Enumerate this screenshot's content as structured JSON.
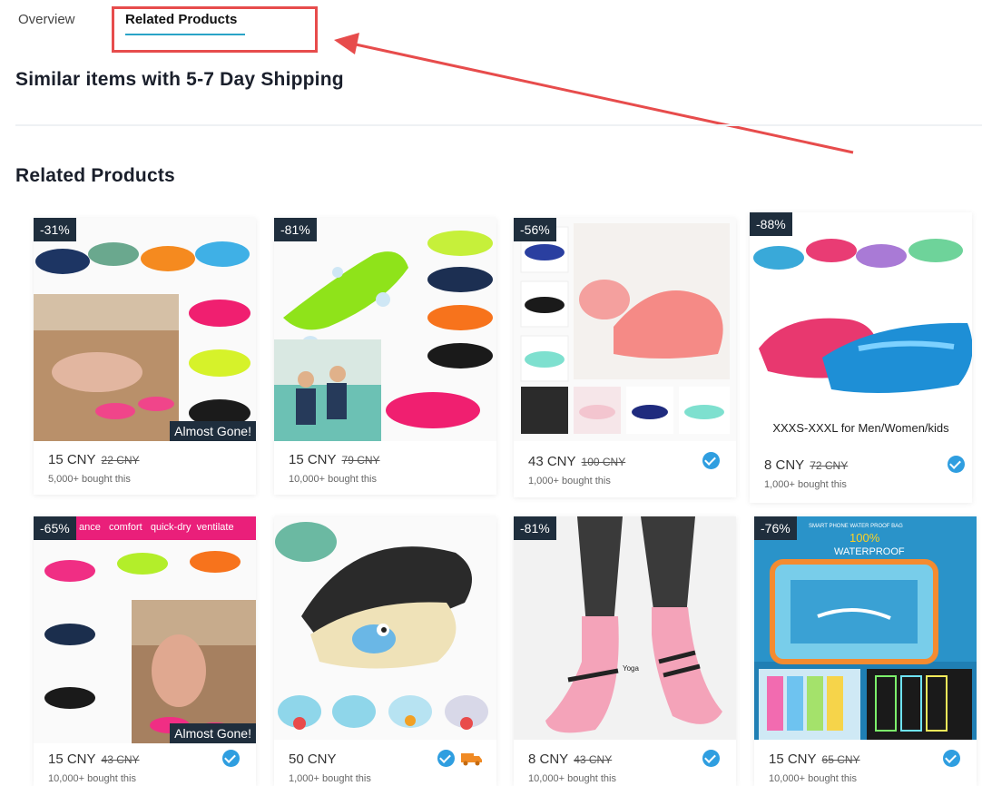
{
  "tabs": [
    {
      "label": "Overview"
    },
    {
      "label": "Related Products",
      "active": true
    }
  ],
  "headings": {
    "shipping": "Similar items with 5-7 Day Shipping",
    "related": "Related Products"
  },
  "colors": {
    "accent": "#2aa3c7",
    "annotation": "#e74c4c",
    "badge_bg": "#1f2e3d",
    "verified": "#2f9ee0"
  },
  "products": [
    {
      "discount": "-31%",
      "price": "15 CNY",
      "old_price": "22 CNY",
      "sold": "5,000+ bought this",
      "flag": "Almost Gone!",
      "verified": false,
      "image_icon": "water-shoes-image"
    },
    {
      "discount": "-81%",
      "price": "15 CNY",
      "old_price": "79 CNY",
      "sold": "10,000+ bought this",
      "verified": false,
      "image_icon": "water-shoes-image"
    },
    {
      "discount": "-56%",
      "price": "43 CNY",
      "old_price": "100 CNY",
      "sold": "1,000+ bought this",
      "verified": true,
      "image_icon": "water-shoes-image"
    },
    {
      "discount": "-88%",
      "price": "8 CNY",
      "old_price": "72 CNY",
      "sold": "1,000+ bought this",
      "caption": "XXXS-XXXL for Men/Women/kids",
      "verified": true,
      "image_icon": "water-shoes-image"
    },
    {
      "discount": "-65%",
      "price": "15 CNY",
      "old_price": "43 CNY",
      "sold": "10,000+ bought this",
      "flag": "Almost Gone!",
      "verified": true,
      "strip": "ance   comfort   quick-dry  ventilate",
      "image_icon": "water-shoes-image"
    },
    {
      "discount": "",
      "price": "50 CNY",
      "old_price": "",
      "sold": "1,000+ bought this",
      "verified": true,
      "truck": true,
      "image_icon": "kids-water-shoes-image"
    },
    {
      "discount": "-81%",
      "price": "8 CNY",
      "old_price": "43 CNY",
      "sold": "10,000+ bought this",
      "verified": true,
      "sock_text": "Yoga",
      "image_icon": "yoga-socks-image"
    },
    {
      "discount": "-76%",
      "price": "15 CNY",
      "old_price": "65 CNY",
      "sold": "10,000+ bought this",
      "verified": true,
      "banner": "SMART PHONE WATER PROOF BAG",
      "banner_pct": "100%",
      "banner_word": "WATERPROOF",
      "image_icon": "waterproof-phone-bag-image"
    }
  ]
}
